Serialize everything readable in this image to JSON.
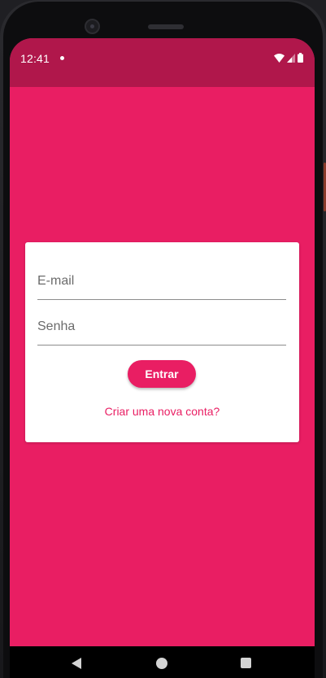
{
  "statusbar": {
    "time": "12:41",
    "icons": [
      "notification-dot-icon",
      "wifi-icon",
      "signal-icon",
      "battery-icon"
    ]
  },
  "login": {
    "email_placeholder": "E-mail",
    "password_placeholder": "Senha",
    "submit_label": "Entrar",
    "create_account_link": "Criar uma nova conta?"
  },
  "navbar": {
    "icons": [
      "back-icon",
      "home-icon",
      "recents-icon"
    ]
  },
  "colors": {
    "primary": "#e91e63",
    "statusbar": "#b0174b",
    "card": "#ffffff"
  }
}
